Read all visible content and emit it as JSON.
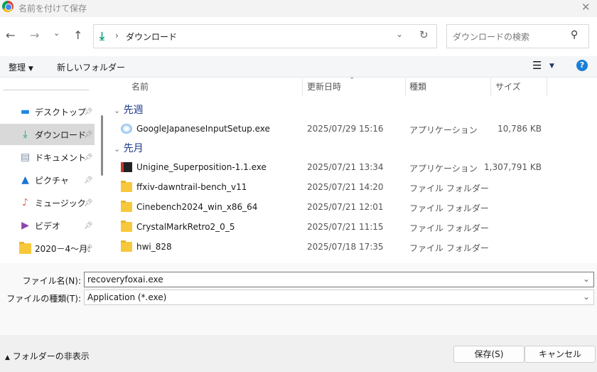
{
  "window": {
    "title": "名前を付けて保存"
  },
  "nav": {
    "path": "ダウンロード",
    "search_placeholder": "ダウンロードの検索"
  },
  "toolbar": {
    "organize": "整理",
    "new_folder": "新しいフォルダー"
  },
  "sidebar": {
    "items": [
      {
        "label": "デスクトップ",
        "icon": "desktop-icon",
        "color": "#1e88e5"
      },
      {
        "label": "ダウンロード",
        "icon": "download-icon",
        "color": "#0f9d7a",
        "selected": true
      },
      {
        "label": "ドキュメント",
        "icon": "document-icon",
        "color": "#7a8fa8"
      },
      {
        "label": "ピクチャ",
        "icon": "picture-icon",
        "color": "#1976d2"
      },
      {
        "label": "ミュージック",
        "icon": "music-icon",
        "color": "#e06a4c"
      },
      {
        "label": "ビデオ",
        "icon": "video-icon",
        "color": "#8e44ad"
      },
      {
        "label": "2020－4～月:",
        "icon": "folder-icon",
        "color": "#f8c83c"
      }
    ]
  },
  "columns": [
    "名前",
    "更新日時",
    "種類",
    "サイズ"
  ],
  "groups": [
    {
      "label": "先週",
      "files": [
        {
          "name": "GoogleJapaneseInputSetup.exe",
          "date": "2025/07/29 15:16",
          "type": "アプリケーション",
          "size": "10,786 KB",
          "icon": "installer-icon"
        }
      ]
    },
    {
      "label": "先月",
      "files": [
        {
          "name": "Unigine_Superposition-1.1.exe",
          "date": "2025/07/21 13:34",
          "type": "アプリケーション",
          "size": "1,307,791 KB",
          "icon": "app-icon"
        },
        {
          "name": "ffxiv-dawntrail-bench_v11",
          "date": "2025/07/21 14:20",
          "type": "ファイル フォルダー",
          "size": "",
          "icon": "folder-icon"
        },
        {
          "name": "Cinebench2024_win_x86_64",
          "date": "2025/07/21 12:01",
          "type": "ファイル フォルダー",
          "size": "",
          "icon": "folder-icon"
        },
        {
          "name": "CrystalMarkRetro2_0_5",
          "date": "2025/07/21 11:15",
          "type": "ファイル フォルダー",
          "size": "",
          "icon": "folder-icon"
        },
        {
          "name": "hwi_828",
          "date": "2025/07/18 17:35",
          "type": "ファイル フォルダー",
          "size": "",
          "icon": "folder-icon"
        }
      ]
    }
  ],
  "form": {
    "filename_label": "ファイル名(N):",
    "filename_value": "recoveryfoxai.exe",
    "filetype_label": "ファイルの種類(T):",
    "filetype_value": "Application (*.exe)"
  },
  "footer": {
    "hide_folders": "フォルダーの非表示",
    "save": "保存(S)",
    "cancel": "キャンセル"
  }
}
